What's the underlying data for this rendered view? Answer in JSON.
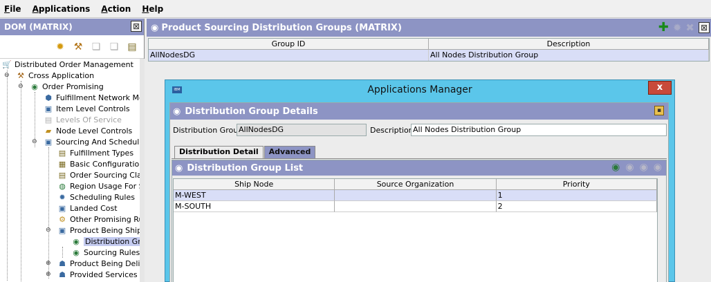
{
  "menu": {
    "items": [
      {
        "label": "File",
        "key": "F",
        "rest": "ile"
      },
      {
        "label": "Applications",
        "key": "A",
        "rest": "pplications"
      },
      {
        "label": "Action",
        "key": "A",
        "rest": "ction"
      },
      {
        "label": "Help",
        "key": "H",
        "rest": "elp"
      }
    ]
  },
  "left": {
    "title": "DOM (MATRIX)",
    "tree": [
      {
        "label": "Distributed Order Management",
        "icon": "cart-icon"
      },
      {
        "label": "Cross Application",
        "icon": "hammer-icon"
      },
      {
        "label": "Order Promising",
        "icon": "globe-people-icon"
      },
      {
        "label": "Fulfillment Network Mode",
        "icon": "network-icon"
      },
      {
        "label": "Item Level Controls",
        "icon": "cube-icon"
      },
      {
        "label": "Levels Of Service",
        "icon": "truck-icon"
      },
      {
        "label": "Node Level Controls",
        "icon": "node-icon"
      },
      {
        "label": "Sourcing And Scheduling",
        "icon": "cube-icon"
      },
      {
        "label": "Fulfillment Types",
        "icon": "list-icon"
      },
      {
        "label": "Basic Configuration",
        "icon": "grid-icon"
      },
      {
        "label": "Order Sourcing Class",
        "icon": "list-icon"
      },
      {
        "label": "Region Usage For So",
        "icon": "globe-icon"
      },
      {
        "label": "Scheduling Rules",
        "icon": "gear-icon"
      },
      {
        "label": "Landed Cost",
        "icon": "cube-icon"
      },
      {
        "label": "Other Promising Rule",
        "icon": "rule-icon"
      },
      {
        "label": "Product Being Shippe",
        "icon": "cube-icon"
      },
      {
        "label": "Distribution Grou",
        "icon": "globe-people-icon"
      },
      {
        "label": "Sourcing Rules",
        "icon": "globe-people-icon"
      },
      {
        "label": "Product Being Deliver",
        "icon": "people-icon"
      },
      {
        "label": "Provided Services",
        "icon": "people-icon"
      }
    ]
  },
  "right": {
    "title": "Product Sourcing Distribution Groups (MATRIX)",
    "columns": [
      "Group ID",
      "Description"
    ],
    "rows": [
      [
        "AllNodesDG",
        "All Nodes Distribution Group"
      ]
    ]
  },
  "dialog": {
    "title": "Applications Manager",
    "close": "x",
    "section_title": "Distribution Group Details",
    "group_label": "Distribution Group",
    "group_value": "AllNodesDG",
    "desc_label": "Description",
    "desc_value": "All Nodes Distribution Group",
    "tabs": [
      "Distribution Detail",
      "Advanced"
    ],
    "list_title": "Distribution Group List",
    "list_columns": [
      "Ship Node",
      "Source Organization",
      "Priority"
    ],
    "list_rows": [
      [
        "M-WEST",
        "",
        "1"
      ],
      [
        "M-SOUTH",
        "",
        "2"
      ]
    ]
  },
  "colors": {
    "header": "#8d94c4",
    "dialog_frame": "#5bc6ea",
    "selection": "#d9def7",
    "close_button": "#c84a3a"
  }
}
